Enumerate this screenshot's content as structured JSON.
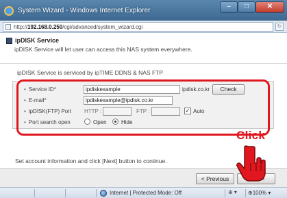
{
  "window": {
    "title": "System Wizard - Windows Internet Explorer",
    "address_prefix": "http://",
    "address_host": "192.168.0.250",
    "address_path": "/cgi/advanced/system_wizard.cgi"
  },
  "header": {
    "title": "ipDISK Service",
    "description": "ipDISK Service will let user can access this NAS system everywhere."
  },
  "content": {
    "intro": "ipDISK Service is serviced by ipTIME DDNS & NAS FTP",
    "form": {
      "service_id_label": "Service ID*",
      "service_id_value": "ipdiskexample",
      "service_id_suffix": "ipdisk.co.kr",
      "check_label": "Check",
      "email_label": "E-mail*",
      "email_value": "ipdiskexample@ipdisk.co.kr",
      "port_label": "ipDISK(FTP) Port",
      "http_label": "HTTP :",
      "http_value": "",
      "ftp_label": "FTP :",
      "ftp_value": "",
      "auto_label": "Auto",
      "auto_checked": true,
      "port_search_label": "Port search open",
      "open_label": "Open",
      "hide_label": "Hide",
      "selected_port_search": "Hide"
    },
    "set_info": "Set account information and click [Next] button to continue."
  },
  "footer": {
    "previous_label": "< Previous",
    "next_label": "Next >"
  },
  "statusbar": {
    "zone_text": "Internet | Protected Mode: Off",
    "protect_text": "⊕ ▾",
    "zoom_text": "⊕100% ▾"
  },
  "annotation": {
    "click_text": "Click"
  },
  "colors": {
    "accent": "#e0171e",
    "titlebar": "#4a779f"
  }
}
